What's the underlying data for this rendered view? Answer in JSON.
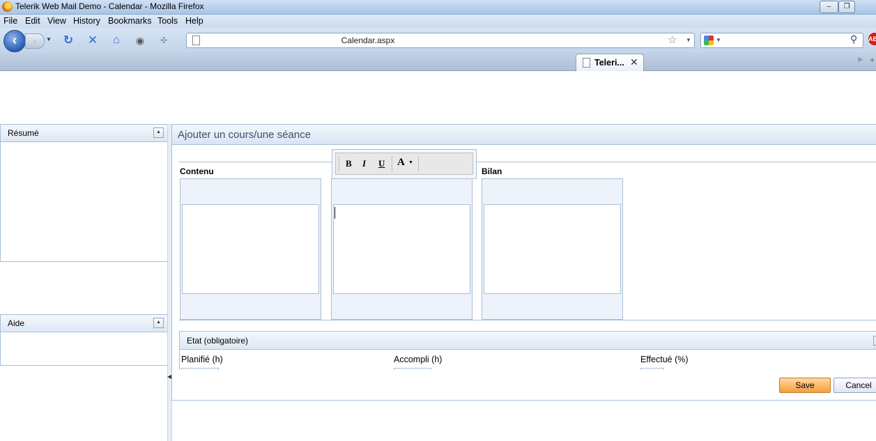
{
  "browser": {
    "window_title": "Telerik Web Mail Demo - Calendar - Mozilla Firefox",
    "menu": [
      "File",
      "Edit",
      "View",
      "History",
      "Bookmarks",
      "Tools",
      "Help"
    ],
    "url": "Calendar.aspx",
    "search_placeholder": "",
    "tab": {
      "label": "Teleri..."
    },
    "window_buttons": {
      "minimize": "–",
      "restore": "❐"
    }
  },
  "icons": {
    "back": "back-arrow-icon",
    "forward": "forward-arrow-icon",
    "reload": "reload-icon",
    "stop": "stop-icon",
    "home": "home-icon",
    "chat": "chat-icon",
    "extension": "extension-icon",
    "bookmark_star": "star-icon",
    "search_engine": "google-icon",
    "search": "magnifier-icon",
    "adblock": "adblock-icon",
    "tab_close": "close-icon",
    "new_tab": "plus-icon"
  },
  "sidebar": {
    "resume": {
      "title": "Résumé"
    },
    "aide": {
      "title": "Aide"
    }
  },
  "main": {
    "title": "Ajouter un cours/une séance",
    "columns": {
      "contenu": "Contenu",
      "middle": "",
      "bilan": "Bilan"
    },
    "format_toolbar": {
      "bold": "B",
      "italic": "I",
      "underline": "U",
      "font_color": "A"
    },
    "etat": {
      "title": "Etat (obligatoire)",
      "fields": {
        "planifie": "Planifié (h)",
        "accompli": "Accompli (h)",
        "effectue": "Effectué (%)"
      }
    },
    "buttons": {
      "save": "Save",
      "cancel": "Cancel"
    }
  },
  "colors": {
    "accent_blue": "#a9bfd6",
    "save_orange": "#f59f3d",
    "title_text": "#3b4f67"
  }
}
